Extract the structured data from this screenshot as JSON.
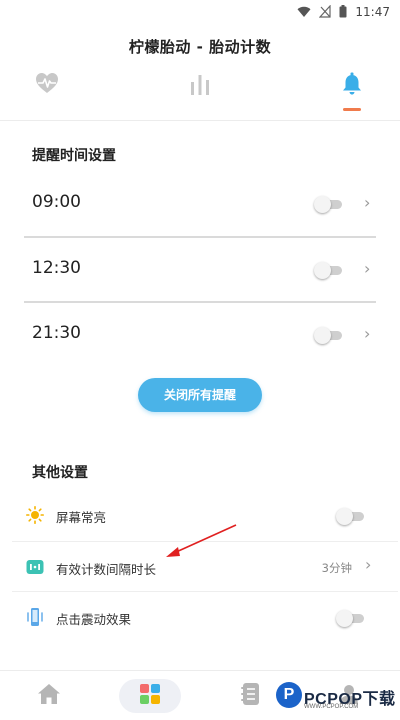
{
  "status_bar": {
    "time": "11:47",
    "icons": [
      "wifi-icon",
      "no-signal-icon",
      "battery-icon"
    ]
  },
  "title": "柠檬胎动 - 胎动计数",
  "tabs": [
    {
      "name": "heart-rate",
      "icon": "heartbeat-icon",
      "active": false
    },
    {
      "name": "statistics",
      "icon": "bar-chart-icon",
      "active": false
    },
    {
      "name": "reminder",
      "icon": "bell-icon",
      "active": true
    }
  ],
  "reminder_section": {
    "title": "提醒时间设置",
    "items": [
      {
        "time": "09:00",
        "enabled": false
      },
      {
        "time": "12:30",
        "enabled": false
      },
      {
        "time": "21:30",
        "enabled": false
      }
    ],
    "close_all_label": "关闭所有提醒"
  },
  "other_section": {
    "title": "其他设置",
    "items": [
      {
        "icon": "sun-icon",
        "label": "屏幕常亮",
        "control": "toggle",
        "enabled": false
      },
      {
        "icon": "interval-icon",
        "label": "有效计数间隔时长",
        "control": "value",
        "value": "3分钟"
      },
      {
        "icon": "vibration-icon",
        "label": "点击震动效果",
        "control": "toggle",
        "enabled": false
      }
    ]
  },
  "bottom_nav": [
    {
      "icon": "home-icon",
      "active": false
    },
    {
      "icon": "apps-grid-icon",
      "active": true
    },
    {
      "icon": "list-icon",
      "active": false
    },
    {
      "icon": "profile-icon",
      "active": false
    }
  ],
  "watermark": {
    "logo_letter": "P",
    "text": "PCPOP下载",
    "sub": "WWW.PCPOP.COM"
  },
  "colors": {
    "accent_blue": "#4ab3e8",
    "active_tab": "#3aaee8",
    "indicator": "#f07b4c",
    "annotation_arrow": "#e02020"
  }
}
